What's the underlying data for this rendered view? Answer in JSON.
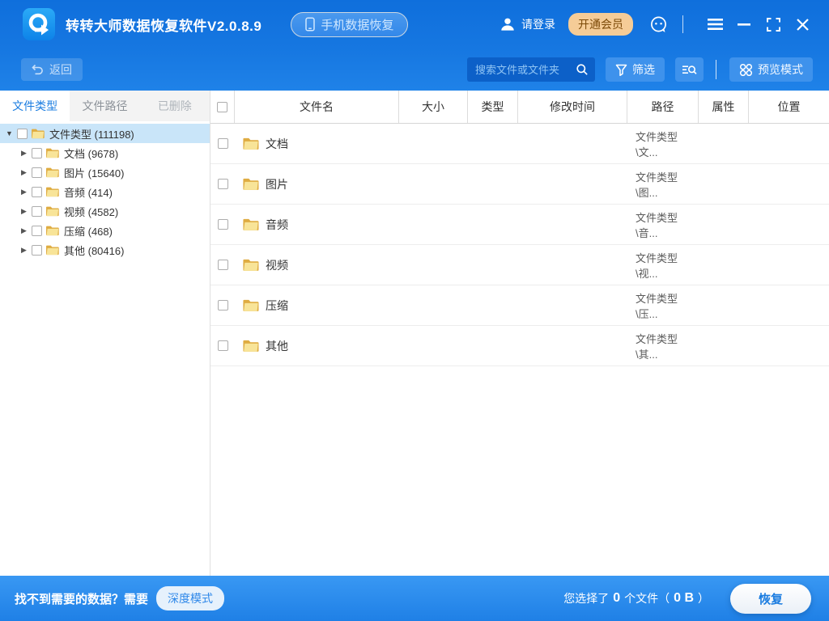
{
  "titlebar": {
    "app_title": "转转大师数据恢复软件V2.0.8.9",
    "phone_recovery_label": "手机数据恢复",
    "login_label": "请登录",
    "vip_label": "开通会员"
  },
  "toolbar": {
    "back_label": "返回",
    "search_placeholder": "搜索文件或文件夹",
    "filter_label": "筛选",
    "preview_label": "预览模式"
  },
  "sidebar": {
    "tabs": [
      {
        "label": "文件类型"
      },
      {
        "label": "文件路径"
      },
      {
        "label": "已删除"
      }
    ],
    "tree": {
      "root_label": "文件类型 (111198)",
      "items": [
        {
          "label": "文档 (9678)"
        },
        {
          "label": "图片 (15640)"
        },
        {
          "label": "音频 (414)"
        },
        {
          "label": "视频 (4582)"
        },
        {
          "label": "压缩 (468)"
        },
        {
          "label": "其他 (80416)"
        }
      ]
    }
  },
  "table": {
    "columns": [
      "文件名",
      "大小",
      "类型",
      "修改时间",
      "路径",
      "属性",
      "位置"
    ],
    "rows": [
      {
        "name": "文档",
        "path": "文件类型\\文..."
      },
      {
        "name": "图片",
        "path": "文件类型\\图..."
      },
      {
        "name": "音频",
        "path": "文件类型\\音..."
      },
      {
        "name": "视频",
        "path": "文件类型\\视..."
      },
      {
        "name": "压缩",
        "path": "文件类型\\压..."
      },
      {
        "name": "其他",
        "path": "文件类型\\其..."
      }
    ]
  },
  "footer": {
    "hint_text": "找不到需要的数据？需要",
    "deep_mode_label": "深度模式",
    "selected_prefix": "您选择了",
    "selected_count": "0",
    "selected_middle": "个文件（",
    "selected_size": "0 B",
    "selected_suffix": "）",
    "recover_label": "恢复"
  },
  "colors": {
    "titlebar_blue": "#1472DE",
    "button_blue": "#3E92EC",
    "vip_tan": "#F5CC97",
    "selected_row": "#C9E5F9",
    "accent_blue": "#1A7CE0"
  }
}
